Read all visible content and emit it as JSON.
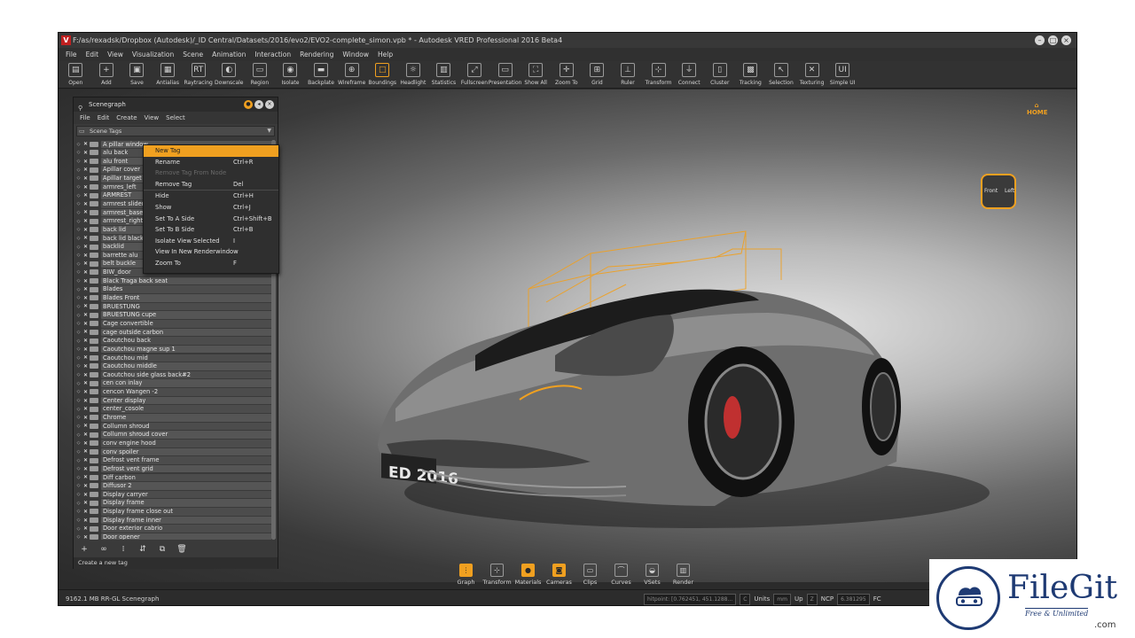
{
  "window": {
    "title": "F:/as/rexadsk/Dropbox (Autodesk)/_ID Central/Datasets/2016/evo2/EVO2-complete_simon.vpb * - Autodesk VRED Professional 2016 Beta4",
    "logo": "V",
    "controls": [
      "–",
      "□",
      "×"
    ]
  },
  "menubar": [
    "File",
    "Edit",
    "View",
    "Visualization",
    "Scene",
    "Animation",
    "Interaction",
    "Rendering",
    "Window",
    "Help"
  ],
  "toolbar": [
    {
      "label": "Open",
      "icon": "open-icon",
      "glyph": "▤"
    },
    {
      "label": "Add",
      "icon": "add-icon",
      "glyph": "+"
    },
    {
      "label": "Save",
      "icon": "save-icon",
      "glyph": "▣"
    },
    {
      "label": "Antialias",
      "icon": "antialias-icon",
      "glyph": "▦"
    },
    {
      "label": "Raytracing",
      "icon": "raytracing-icon",
      "glyph": "RT"
    },
    {
      "label": "Downscale",
      "icon": "downscale-icon",
      "glyph": "◐"
    },
    {
      "label": "Region",
      "icon": "region-icon",
      "glyph": "▭"
    },
    {
      "label": "Isolate",
      "icon": "isolate-icon",
      "glyph": "◉"
    },
    {
      "label": "Backplate",
      "icon": "backplate-icon",
      "glyph": "▬"
    },
    {
      "label": "Wireframe",
      "icon": "wireframe-icon",
      "glyph": "⊕"
    },
    {
      "label": "Boundings",
      "icon": "boundings-icon",
      "glyph": "□",
      "active": true
    },
    {
      "label": "Headlight",
      "icon": "headlight-icon",
      "glyph": "☼"
    },
    {
      "label": "Statistics",
      "icon": "statistics-icon",
      "glyph": "▥"
    },
    {
      "label": "Fullscreen",
      "icon": "fullscreen-icon",
      "glyph": "⤢"
    },
    {
      "label": "Presentation",
      "icon": "presentation-icon",
      "glyph": "▭"
    },
    {
      "label": "Show All",
      "icon": "show-all-icon",
      "glyph": "⛶"
    },
    {
      "label": "Zoom To",
      "icon": "zoom-to-icon",
      "glyph": "✛"
    },
    {
      "label": "Grid",
      "icon": "grid-icon",
      "glyph": "⊞"
    },
    {
      "label": "Ruler",
      "icon": "ruler-icon",
      "glyph": "⊥"
    },
    {
      "label": "Transform",
      "icon": "transform-icon",
      "glyph": "⊹"
    },
    {
      "label": "Connect",
      "icon": "connect-icon",
      "glyph": "⏚"
    },
    {
      "label": "Cluster",
      "icon": "cluster-icon",
      "glyph": "▯"
    },
    {
      "label": "Tracking",
      "icon": "tracking-icon",
      "glyph": "▩"
    },
    {
      "label": "Selection",
      "icon": "selection-icon",
      "glyph": "↖"
    },
    {
      "label": "Texturing",
      "icon": "texturing-icon",
      "glyph": "✕"
    },
    {
      "label": "Simple UI",
      "icon": "simple-ui-icon",
      "glyph": "UI"
    }
  ],
  "viewcube": {
    "front": "Front",
    "left": "Left",
    "home": "HOME"
  },
  "car_plate": "ED 2016",
  "dock": [
    {
      "label": "Graph",
      "icon": "graph-icon",
      "glyph": "⋮",
      "active": true
    },
    {
      "label": "Transform",
      "icon": "dock-transform-icon",
      "glyph": "⊹"
    },
    {
      "label": "Materials",
      "icon": "materials-icon",
      "glyph": "●",
      "active": true
    },
    {
      "label": "Cameras",
      "icon": "cameras-icon",
      "glyph": "◙",
      "active": true
    },
    {
      "label": "Clips",
      "icon": "clips-icon",
      "glyph": "▭"
    },
    {
      "label": "Curves",
      "icon": "curves-icon",
      "glyph": "⌒"
    },
    {
      "label": "VSets",
      "icon": "vsets-icon",
      "glyph": "◒"
    },
    {
      "label": "Render",
      "icon": "render-icon",
      "glyph": "▥"
    }
  ],
  "status": {
    "left": "9162.1 MB  RR-GL  Scenegraph",
    "hitpoint": "hitpoint: [0.762451, 451.1288...",
    "c_btn": "C",
    "units_label": "Units",
    "units_value": "mm",
    "up_label": "Up",
    "up_value": "Z",
    "ncp_label": "NCP",
    "ncp_value": "6.381295",
    "fc_label": "FC"
  },
  "scenegraph": {
    "title": "Scenegraph",
    "menu": [
      "File",
      "Edit",
      "Create",
      "View",
      "Select"
    ],
    "dropdown": "Scene Tags",
    "items": [
      "A pillar window",
      "alu back",
      "alu front",
      "Apillar cover",
      "Apillar target",
      "armres_left",
      "ARMREST",
      "armrest slider",
      "armrest_base",
      "armrest_right",
      "back lid",
      "back lid black",
      "backlid",
      "barrette alu",
      "belt buckle",
      "BIW_door",
      "Black Traga  back seat",
      "Blades",
      "Blades Front",
      "BRUESTUNG",
      "BRUESTUNG cupe",
      "Cage  convertible",
      "cage outside carbon",
      "Caoutchou back",
      "Caoutchou magne sup 1",
      "Caoutchou mid",
      "Caoutchou middle",
      "Caoutchou side glass back#2",
      "cen con inlay",
      "cencon Wangen -2",
      "Center display",
      "center_cosole",
      "Chrome",
      "Collumn shroud",
      "Collumn shroud cover",
      "conv engine hood",
      "conv spoiler",
      "Defrost vent frame",
      "Defrost vent grid",
      "Diff carbon",
      "Diffusor 2",
      "Display carryer",
      "Display frame",
      "Display frame close out",
      "Display frame inner",
      "Door exterior cabrio",
      "Door opener"
    ],
    "bottom_icons": [
      "+",
      "∞",
      "⁞",
      "⇵",
      "⧉",
      "🗑"
    ],
    "status": "Create a new tag"
  },
  "context_menu": [
    {
      "label": "New Tag",
      "shortcut": "",
      "highlight": true
    },
    {
      "label": "Rename",
      "shortcut": "Ctrl+R"
    },
    {
      "label": "Remove Tag From Node",
      "shortcut": "",
      "disabled": true
    },
    {
      "label": "Remove Tag",
      "shortcut": "Del"
    },
    {
      "sep": true
    },
    {
      "label": "Hide",
      "shortcut": "Ctrl+H"
    },
    {
      "label": "Show",
      "shortcut": "Ctrl+J"
    },
    {
      "label": "Set To A Side",
      "shortcut": "Ctrl+Shift+B"
    },
    {
      "label": "Set To B Side",
      "shortcut": "Ctrl+B"
    },
    {
      "label": "Isolate View Selected",
      "shortcut": "I"
    },
    {
      "label": "View In New Renderwindow",
      "shortcut": ""
    },
    {
      "label": "Zoom To",
      "shortcut": "F"
    }
  ],
  "watermark": {
    "name": "FileGit",
    "tagline": "Free & Unlimited",
    "suffix": ".com"
  },
  "colors": {
    "accent": "#f0a020",
    "panel": "#3a3a3a",
    "brand": "#1e3a73"
  }
}
